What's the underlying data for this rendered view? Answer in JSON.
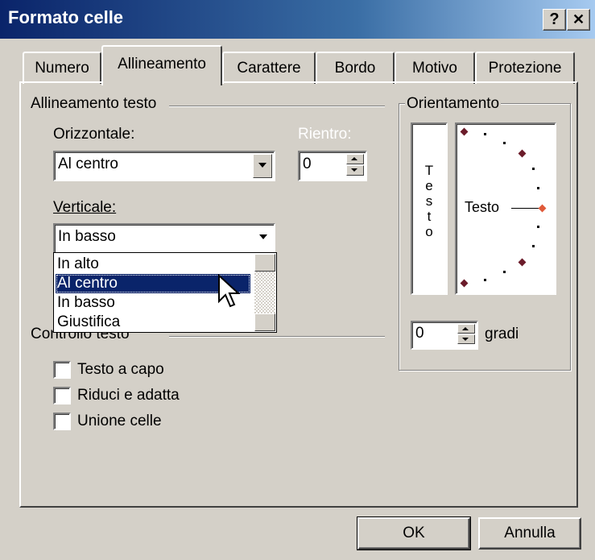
{
  "window": {
    "title": "Formato celle",
    "help_label": "?",
    "close_label": "✕"
  },
  "tabs": [
    {
      "label": "Numero"
    },
    {
      "label": "Allineamento"
    },
    {
      "label": "Carattere"
    },
    {
      "label": "Bordo"
    },
    {
      "label": "Motivo"
    },
    {
      "label": "Protezione"
    }
  ],
  "align": {
    "group_label": "Allineamento testo",
    "horizontal_label": "Orizzontale:",
    "horizontal_value": "Al centro",
    "indent_label": "Rientro:",
    "indent_value": "0",
    "vertical_label": "Verticale:",
    "vertical_value": "In basso",
    "vertical_options": [
      "In alto",
      "Al centro",
      "In basso",
      "Giustifica"
    ],
    "selected_option": "Al centro"
  },
  "control": {
    "group_label": "Controllo testo",
    "wrap_label": "Testo a capo",
    "shrink_label": "Riduci e adatta",
    "merge_label": "Unione celle"
  },
  "orientation": {
    "group_label": "Orientamento",
    "vertical_text": [
      "T",
      "e",
      "s",
      "t",
      "o"
    ],
    "dial_text": "Testo",
    "degrees_value": "0",
    "degrees_label": "gradi",
    "accent_color": "#e05a3a",
    "marker_color": "#6b1c2a"
  },
  "buttons": {
    "ok": "OK",
    "cancel": "Annulla"
  }
}
